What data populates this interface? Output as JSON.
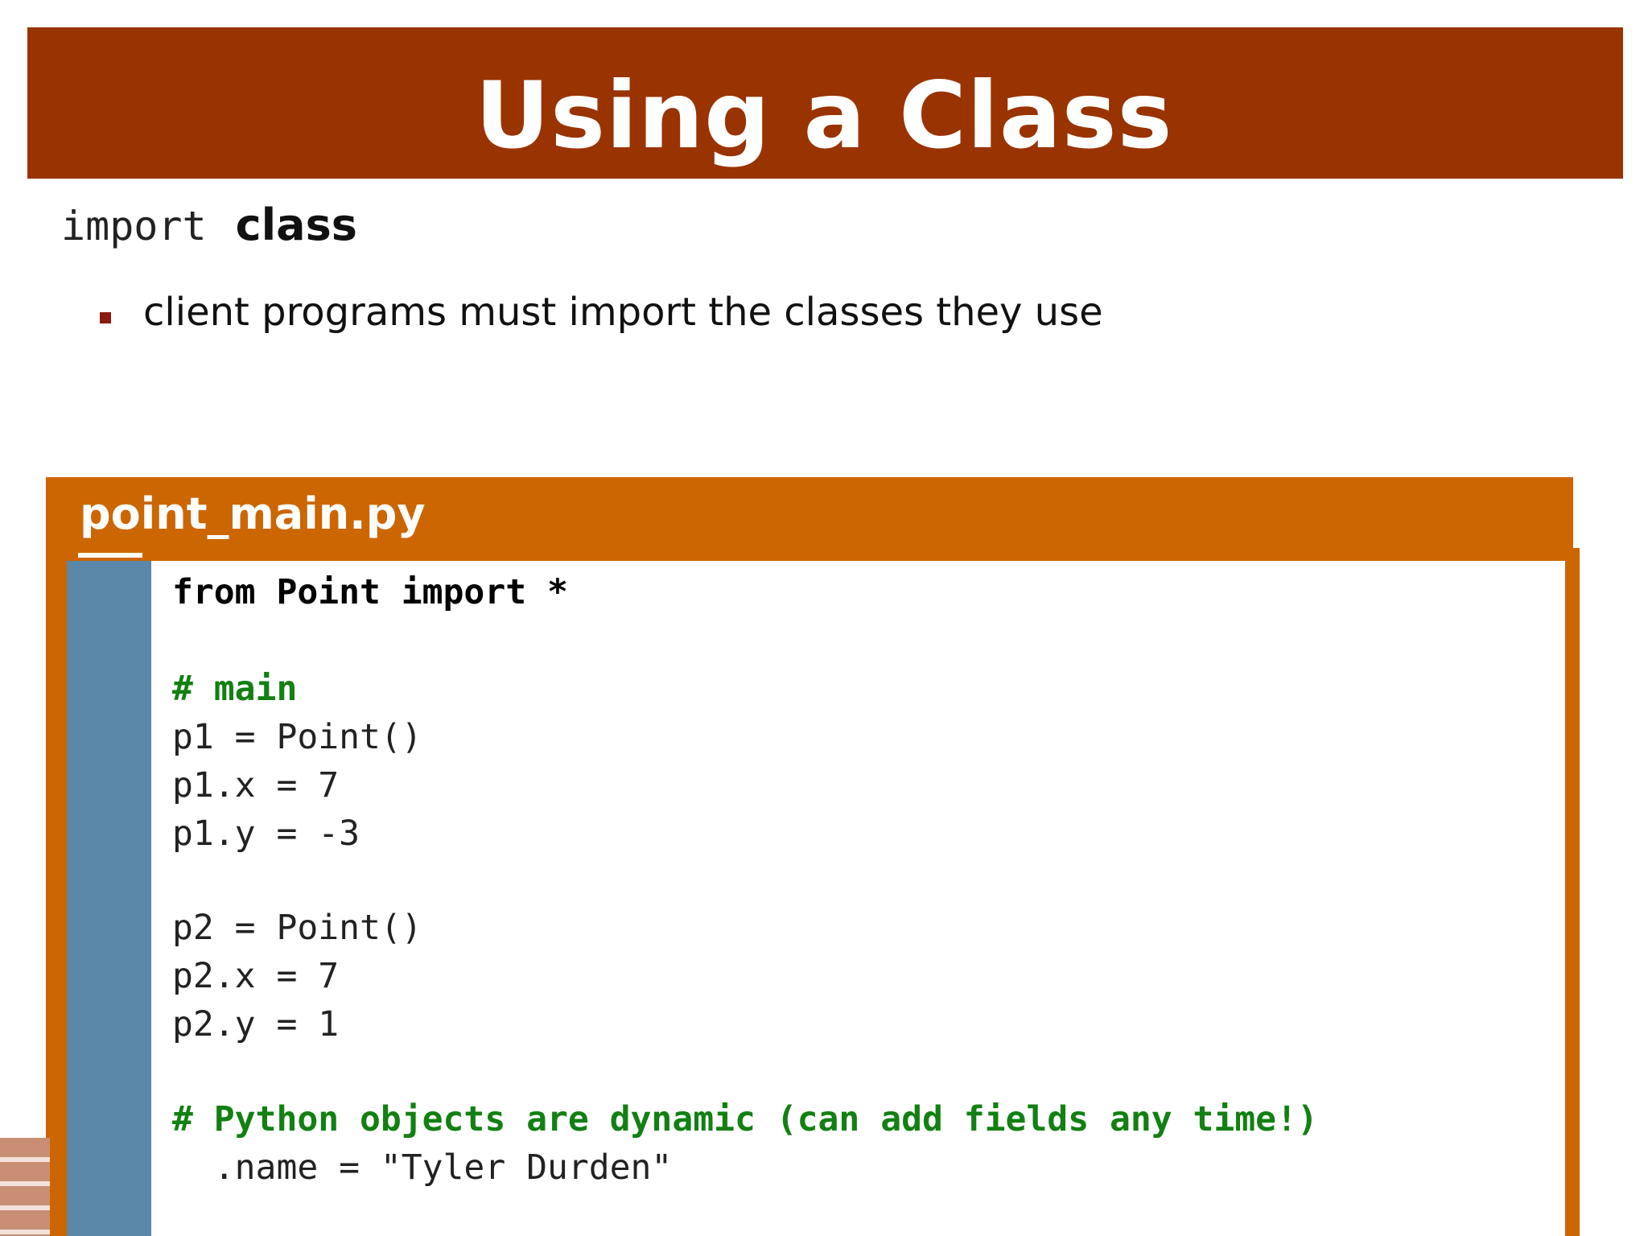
{
  "slide": {
    "title": "Using a Class",
    "heading_code": "import",
    "heading_bold": "class",
    "bullets": [
      "client programs must import the classes they use"
    ]
  },
  "colors": {
    "title_bar": "#993300",
    "panel_orange": "#cc6600",
    "gutter_blue": "#5b87a8",
    "comment_green": "#128012",
    "bullet_marker": "#8b1a10"
  },
  "code_panel": {
    "filename": "point_main.py",
    "lines": [
      "from Point import *",
      "",
      "# main",
      "p1 = Point()",
      "p1.x = 7",
      "p1.y = -3",
      "",
      "p2 = Point()",
      "p2.x = 7",
      "p2.y = 1",
      "",
      "# Python objects are dynamic (can add fields any time!)",
      "  .name = \"Tyler Durden\""
    ]
  }
}
